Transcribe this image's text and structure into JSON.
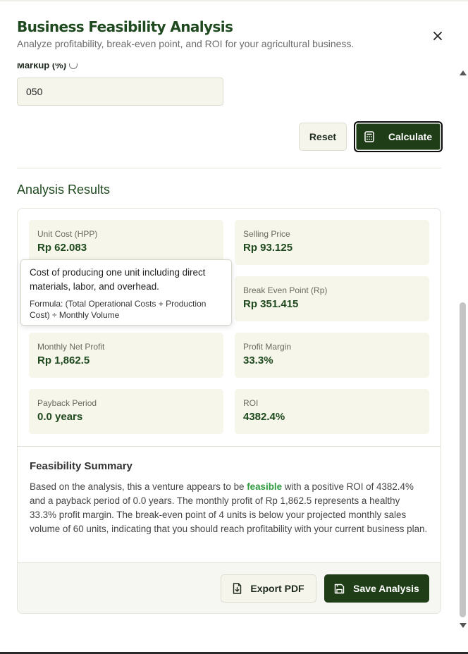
{
  "dialog": {
    "title": "Business Feasibility Analysis",
    "subtitle": "Analyze profitability, break-even point, and ROI for your agricultural business."
  },
  "form": {
    "markup_label": "Markup (%)",
    "markup_value": "050",
    "reset_label": "Reset",
    "calculate_label": "Calculate"
  },
  "results": {
    "heading": "Analysis Results",
    "metrics": [
      {
        "label": "Unit Cost (HPP)",
        "value": "Rp 62.083"
      },
      {
        "label": "Selling Price",
        "value": "Rp 93.125"
      },
      {
        "label": "",
        "value": ""
      },
      {
        "label": "Break Even Point (Rp)",
        "value": "Rp 351.415"
      },
      {
        "label": "Monthly Net Profit",
        "value": "Rp 1,862.5"
      },
      {
        "label": "Profit Margin",
        "value": "33.3%"
      },
      {
        "label": "Payback Period",
        "value": "0.0 years"
      },
      {
        "label": "ROI",
        "value": "4382.4%"
      }
    ]
  },
  "tooltip": {
    "description": "Cost of producing one unit including direct materials, labor, and overhead.",
    "formula": "Formula: (Total Operational Costs + Production Cost) ÷ Monthly Volume"
  },
  "summary": {
    "title": "Feasibility Summary",
    "text_before": "Based on the analysis, this a venture appears to be ",
    "highlight": "feasible",
    "text_after": " with a positive ROI of 4382.4% and a payback period of 0.0 years. The monthly profit of Rp 1,862.5 represents a healthy 33.3% profit margin. The break-even point of 4 units is below your projected monthly sales volume of 60 units, indicating that you should reach profitability with your current business plan."
  },
  "footer": {
    "export_label": "Export PDF",
    "save_label": "Save Analysis"
  },
  "icons": {
    "close": "close-icon",
    "calculator": "calculator-icon",
    "export": "file-download-icon",
    "save": "save-icon",
    "info": "info-icon"
  },
  "colors": {
    "brand_dark_green": "#1f3d17",
    "heading_green": "#1f4a1f",
    "feasible_green": "#2e9a3e",
    "metric_bg": "#f6f6ea"
  }
}
